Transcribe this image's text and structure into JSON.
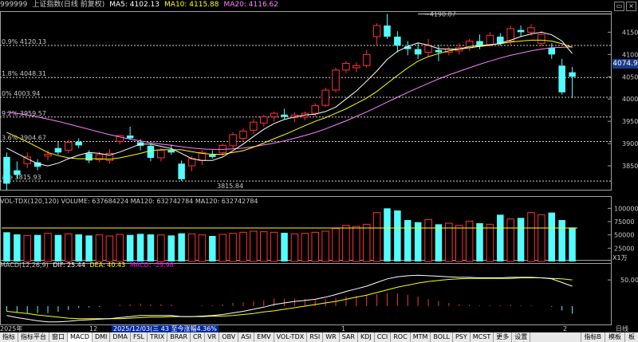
{
  "colors": {
    "up": "#ff3232",
    "down": "#54fcfc",
    "ma5": "#ffffff",
    "ma10": "#ffff00",
    "ma20": "#ff80ff",
    "mavol": "#ffff00",
    "dif": "#ffffff",
    "dea": "#ffff00",
    "macd": "#ff00ff",
    "grid": "#8a8a8a",
    "border": "#a0a0a0"
  },
  "header": {
    "code": "999999",
    "name": "上证指数(日线 前复权)",
    "ma5_label": "MA5: 4102.13",
    "ma10_label": "MA10: 4115.88",
    "ma20_label": "MA20: 4116.62"
  },
  "price_tag": "4074.9",
  "price_axis": {
    "labels": [
      "4150",
      "4100",
      "4050",
      "4000",
      "3950",
      "3900",
      "3850"
    ],
    "min": 3800,
    "max": 4190
  },
  "fib_levels": [
    {
      "label": "0.9% 4120.13",
      "value": 4120.13
    },
    {
      "label": "1.8% 4048.31",
      "value": 4048.31
    },
    {
      "label": "0% 4003.94",
      "value": 4003.94
    },
    {
      "label": "9.2% 3959.57",
      "value": 3959.57
    },
    {
      "label": "3.6% 3904.67",
      "value": 3904.67
    },
    {
      "label": "ase 3815.93",
      "value": 3815.93
    }
  ],
  "annotations": {
    "high": "4190.87",
    "low": "3815.84"
  },
  "volume": {
    "title": "VOL-TDX(120,120)  VOLUME: 637684224  MA120: 632742784  MA120: 632742784",
    "axis": [
      "100000",
      "75000",
      "50000",
      "25000"
    ],
    "max": 105000,
    "mavol": 63000,
    "unit": "X1万"
  },
  "macd": {
    "title_name": "MACD(12,26,9)",
    "dif_label": "DIF: 25.44",
    "dea_label": "DEA: 40.43",
    "macd_label": "MACD: -29.98",
    "axis": [
      "50.00"
    ]
  },
  "datebar": {
    "year": "2025年",
    "m12": "12",
    "m1": "1",
    "m2": "2",
    "hl": "2025/12/03(三 43 至今涨幅4.36%",
    "right": "日线"
  },
  "tabs": [
    "指标",
    "指标平台",
    "窗口",
    "MACD",
    "DMI",
    "DMA",
    "FSL",
    "TRIX",
    "BRAR",
    "CR",
    "VR",
    "OBV",
    "ASI",
    "EMV",
    "VOL-TDX",
    "RSI",
    "WR",
    "SAR",
    "KDJ",
    "CCI",
    "ROC",
    "MTM",
    "BOLL",
    "PSY",
    "MCST",
    "更多",
    "设置"
  ],
  "right_tabs": [
    "指标B",
    "模板",
    "板"
  ],
  "chart_data": {
    "type": "candlestick",
    "title": "上证指数(日线 前复权)",
    "ylim": [
      3800,
      4190
    ],
    "candles": [
      {
        "o": 3870,
        "h": 3880,
        "l": 3795,
        "c": 3810
      },
      {
        "o": 3840,
        "h": 3860,
        "l": 3822,
        "c": 3830
      },
      {
        "o": 3855,
        "h": 3880,
        "l": 3845,
        "c": 3870
      },
      {
        "o": 3858,
        "h": 3865,
        "l": 3840,
        "c": 3848
      },
      {
        "o": 3872,
        "h": 3885,
        "l": 3862,
        "c": 3876
      },
      {
        "o": 3890,
        "h": 3905,
        "l": 3875,
        "c": 3880
      },
      {
        "o": 3885,
        "h": 3908,
        "l": 3879,
        "c": 3903
      },
      {
        "o": 3904,
        "h": 3912,
        "l": 3890,
        "c": 3896
      },
      {
        "o": 3878,
        "h": 3885,
        "l": 3856,
        "c": 3862
      },
      {
        "o": 3864,
        "h": 3882,
        "l": 3858,
        "c": 3875
      },
      {
        "o": 3862,
        "h": 3888,
        "l": 3855,
        "c": 3878
      },
      {
        "o": 3905,
        "h": 3920,
        "l": 3898,
        "c": 3918
      },
      {
        "o": 3918,
        "h": 3938,
        "l": 3908,
        "c": 3912
      },
      {
        "o": 3903,
        "h": 3910,
        "l": 3885,
        "c": 3895
      },
      {
        "o": 3895,
        "h": 3900,
        "l": 3860,
        "c": 3868
      },
      {
        "o": 3868,
        "h": 3890,
        "l": 3860,
        "c": 3885
      },
      {
        "o": 3885,
        "h": 3898,
        "l": 3875,
        "c": 3880
      },
      {
        "o": 3855,
        "h": 3862,
        "l": 3816,
        "c": 3820
      },
      {
        "o": 3850,
        "h": 3872,
        "l": 3838,
        "c": 3866
      },
      {
        "o": 3862,
        "h": 3885,
        "l": 3852,
        "c": 3880
      },
      {
        "o": 3875,
        "h": 3885,
        "l": 3866,
        "c": 3870
      },
      {
        "o": 3880,
        "h": 3900,
        "l": 3872,
        "c": 3896
      },
      {
        "o": 3895,
        "h": 3925,
        "l": 3888,
        "c": 3920
      },
      {
        "o": 3912,
        "h": 3935,
        "l": 3905,
        "c": 3928
      },
      {
        "o": 3930,
        "h": 3955,
        "l": 3922,
        "c": 3948
      },
      {
        "o": 3946,
        "h": 3965,
        "l": 3938,
        "c": 3960
      },
      {
        "o": 3960,
        "h": 3972,
        "l": 3950,
        "c": 3968
      },
      {
        "o": 3965,
        "h": 3978,
        "l": 3955,
        "c": 3960
      },
      {
        "o": 3958,
        "h": 3970,
        "l": 3948,
        "c": 3964
      },
      {
        "o": 3960,
        "h": 3972,
        "l": 3952,
        "c": 3968
      },
      {
        "o": 3968,
        "h": 3990,
        "l": 3960,
        "c": 3985
      },
      {
        "o": 3986,
        "h": 4025,
        "l": 3982,
        "c": 4020
      },
      {
        "o": 4020,
        "h": 4070,
        "l": 4015,
        "c": 4065
      },
      {
        "o": 4065,
        "h": 4085,
        "l": 4058,
        "c": 4080
      },
      {
        "o": 4070,
        "h": 4082,
        "l": 4060,
        "c": 4075
      },
      {
        "o": 4075,
        "h": 4110,
        "l": 4070,
        "c": 4100
      },
      {
        "o": 4140,
        "h": 4170,
        "l": 4120,
        "c": 4165
      },
      {
        "o": 4165,
        "h": 4190.87,
        "l": 4135,
        "c": 4140
      },
      {
        "o": 4140,
        "h": 4152,
        "l": 4105,
        "c": 4120
      },
      {
        "o": 4118,
        "h": 4130,
        "l": 4098,
        "c": 4112
      },
      {
        "o": 4112,
        "h": 4125,
        "l": 4090,
        "c": 4100
      },
      {
        "o": 4105,
        "h": 4135,
        "l": 4095,
        "c": 4120
      },
      {
        "o": 4110,
        "h": 4122,
        "l": 4085,
        "c": 4105
      },
      {
        "o": 4105,
        "h": 4118,
        "l": 4098,
        "c": 4112
      },
      {
        "o": 4108,
        "h": 4125,
        "l": 4100,
        "c": 4115
      },
      {
        "o": 4115,
        "h": 4135,
        "l": 4108,
        "c": 4130
      },
      {
        "o": 4130,
        "h": 4145,
        "l": 4112,
        "c": 4118
      },
      {
        "o": 4122,
        "h": 4150,
        "l": 4118,
        "c": 4143
      },
      {
        "o": 4140,
        "h": 4148,
        "l": 4120,
        "c": 4125
      },
      {
        "o": 4130,
        "h": 4165,
        "l": 4122,
        "c": 4158
      },
      {
        "o": 4155,
        "h": 4165,
        "l": 4140,
        "c": 4150
      },
      {
        "o": 4150,
        "h": 4168,
        "l": 4142,
        "c": 4160
      },
      {
        "o": 4125,
        "h": 4152,
        "l": 4118,
        "c": 4145
      },
      {
        "o": 4115,
        "h": 4125,
        "l": 4090,
        "c": 4100
      },
      {
        "o": 4075,
        "h": 4090,
        "l": 4010,
        "c": 4015
      },
      {
        "o": 4060,
        "h": 4072,
        "l": 4002,
        "c": 4050
      }
    ],
    "ma5": [
      3890,
      3878,
      3866,
      3855,
      3850,
      3856,
      3866,
      3874,
      3880,
      3878,
      3874,
      3881,
      3890,
      3899,
      3899,
      3894,
      3889,
      3878,
      3866,
      3862,
      3862,
      3870,
      3884,
      3899,
      3916,
      3932,
      3945,
      3954,
      3960,
      3964,
      3966,
      3972,
      3982,
      4000,
      4018,
      4040,
      4063,
      4089,
      4107,
      4118,
      4126,
      4121,
      4113,
      4112,
      4112,
      4115,
      4118,
      4121,
      4125,
      4132,
      4140,
      4146,
      4150,
      4144,
      4130,
      4102
    ],
    "ma10": [
      3925,
      3915,
      3904,
      3892,
      3880,
      3873,
      3868,
      3866,
      3866,
      3866,
      3865,
      3868,
      3873,
      3878,
      3884,
      3886,
      3886,
      3886,
      3882,
      3878,
      3876,
      3876,
      3880,
      3884,
      3892,
      3901,
      3911,
      3920,
      3930,
      3940,
      3950,
      3958,
      3968,
      3978,
      3990,
      4002,
      4017,
      4035,
      4053,
      4070,
      4085,
      4095,
      4102,
      4108,
      4112,
      4118,
      4120,
      4122,
      4124,
      4128,
      4130,
      4132,
      4132,
      4130,
      4124,
      4116
    ],
    "ma20": [
      3970,
      3968,
      3964,
      3960,
      3955,
      3950,
      3944,
      3938,
      3932,
      3926,
      3920,
      3915,
      3910,
      3906,
      3902,
      3899,
      3896,
      3893,
      3890,
      3888,
      3887,
      3887,
      3888,
      3890,
      3893,
      3897,
      3901,
      3906,
      3912,
      3918,
      3925,
      3933,
      3942,
      3951,
      3961,
      3971,
      3982,
      3993,
      4004,
      4015,
      4025,
      4035,
      4045,
      4054,
      4062,
      4070,
      4078,
      4085,
      4092,
      4098,
      4103,
      4108,
      4112,
      4115,
      4116,
      4117
    ],
    "volume": [
      55000,
      51000,
      49000,
      50000,
      53000,
      50000,
      52000,
      51000,
      49000,
      50000,
      48000,
      51000,
      50000,
      52000,
      51000,
      50000,
      49000,
      53000,
      52000,
      50000,
      48000,
      51000,
      53000,
      55000,
      57000,
      56000,
      55000,
      54000,
      52000,
      53000,
      55000,
      57000,
      62000,
      68000,
      66000,
      70000,
      92000,
      100000,
      96000,
      78000,
      74000,
      79000,
      70000,
      72000,
      68000,
      76000,
      72000,
      70000,
      88000,
      80000,
      82000,
      92000,
      88000,
      92000,
      78000,
      64000
    ],
    "dif": [
      -18,
      -22,
      -25,
      -28,
      -30,
      -30,
      -29,
      -27,
      -26,
      -25,
      -24,
      -22,
      -20,
      -18,
      -18,
      -18,
      -18,
      -20,
      -20,
      -19,
      -18,
      -16,
      -13,
      -10,
      -6,
      -2,
      3,
      6,
      9,
      11,
      13,
      17,
      22,
      28,
      33,
      38,
      45,
      52,
      56,
      58,
      59,
      58,
      57,
      56,
      55,
      55,
      54,
      54,
      54,
      55,
      55,
      55,
      54,
      52,
      45,
      38
    ],
    "dea": [
      -10,
      -12,
      -14,
      -17,
      -19,
      -21,
      -23,
      -24,
      -24,
      -24,
      -24,
      -24,
      -23,
      -22,
      -21,
      -21,
      -20,
      -20,
      -20,
      -20,
      -19,
      -19,
      -18,
      -16,
      -14,
      -11,
      -9,
      -6,
      -3,
      0,
      3,
      6,
      9,
      13,
      17,
      21,
      26,
      31,
      36,
      40,
      44,
      47,
      49,
      51,
      52,
      53,
      53,
      53,
      53,
      53,
      54,
      54,
      54,
      53,
      52,
      50
    ],
    "macd": [
      -16,
      -20,
      -22,
      -22,
      -22,
      -18,
      -12,
      -6,
      -4,
      -2,
      0,
      4,
      6,
      8,
      6,
      6,
      4,
      0,
      0,
      2,
      2,
      6,
      10,
      12,
      16,
      18,
      24,
      24,
      24,
      22,
      20,
      22,
      26,
      30,
      32,
      34,
      38,
      42,
      40,
      36,
      30,
      22,
      16,
      10,
      6,
      4,
      2,
      2,
      2,
      4,
      2,
      2,
      0,
      -2,
      -14,
      -24
    ]
  }
}
